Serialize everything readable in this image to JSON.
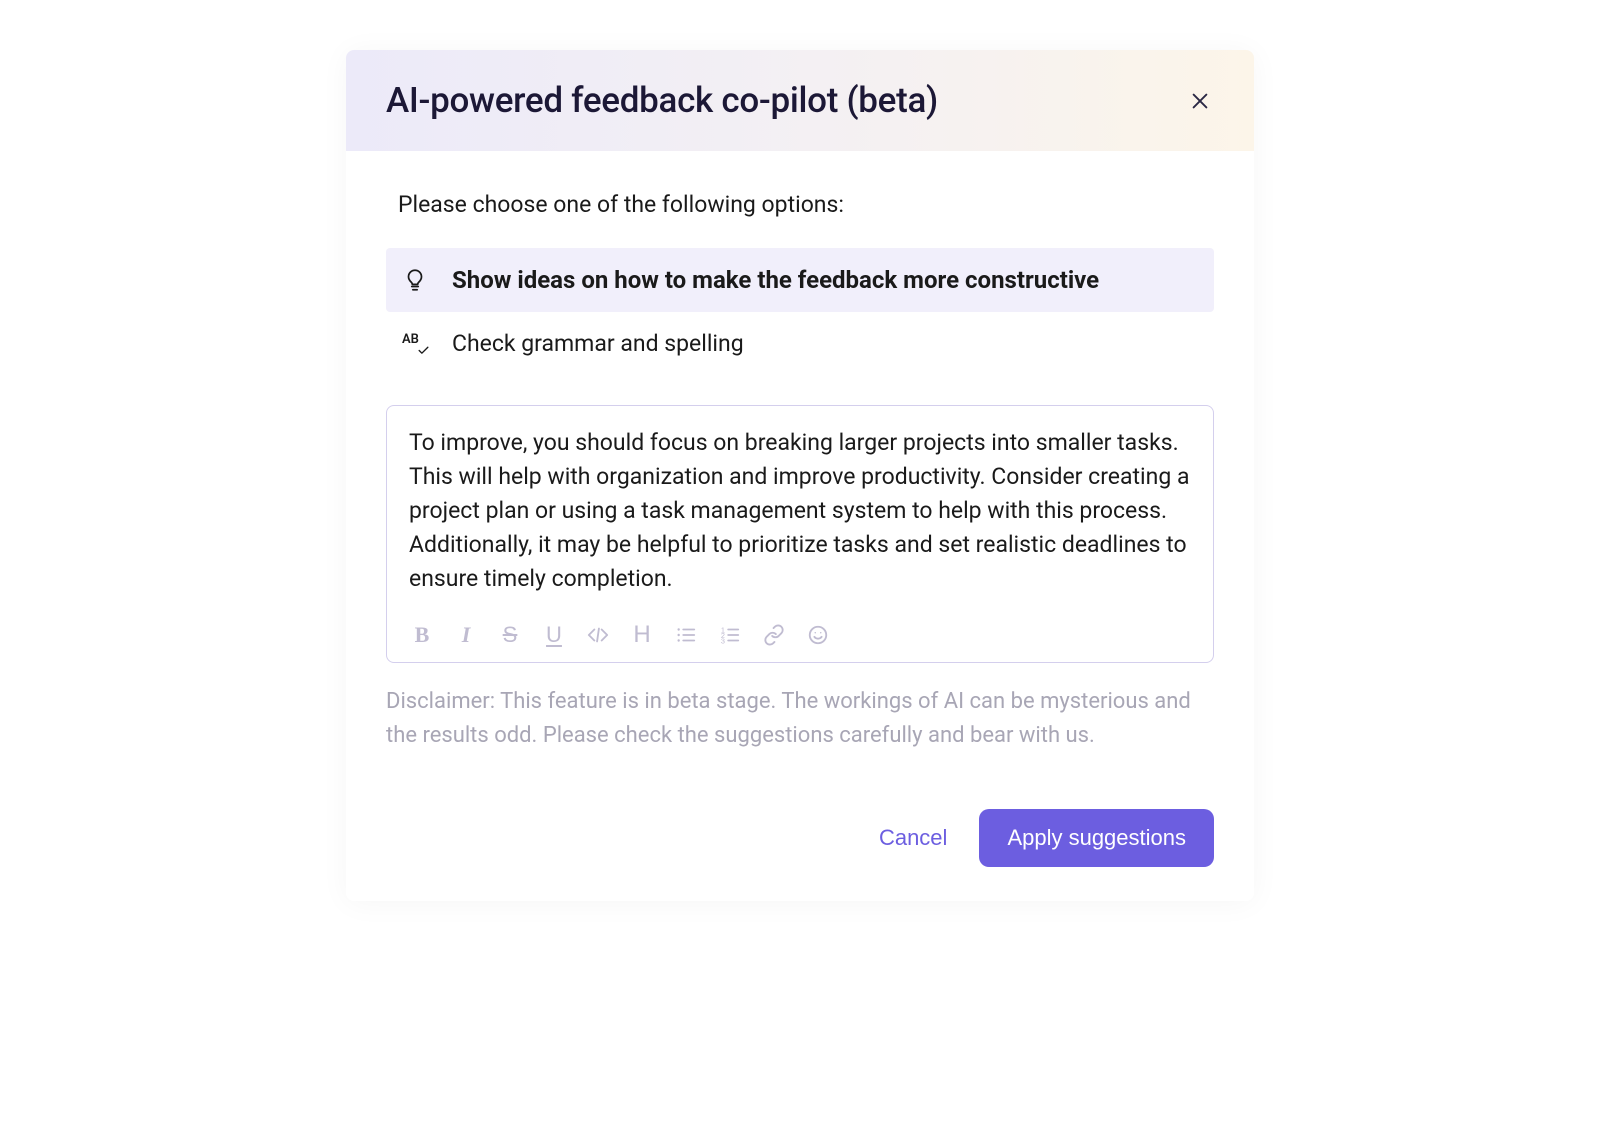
{
  "header": {
    "title": "AI-powered feedback co-pilot (beta)"
  },
  "body": {
    "prompt": "Please choose one of the following options:",
    "options": [
      {
        "label": "Show ideas on how to make the feedback more constructive",
        "selected": true,
        "icon": "lightbulb"
      },
      {
        "label": "Check grammar and spelling",
        "selected": false,
        "icon": "spellcheck"
      }
    ],
    "editor_content": "To improve, you should focus on breaking larger projects into smaller tasks. This will help with organization and improve productivity. Consider creating a project plan or using a task management system to help with this process. Additionally, it may be helpful to prioritize tasks and set realistic deadlines to ensure timely completion.",
    "toolbar": {
      "bold": "B",
      "italic": "I",
      "strike": "S",
      "underline": "U",
      "heading": "H"
    },
    "disclaimer": "Disclaimer: This feature is in beta stage. The workings of AI can be mysterious and the results odd. Please check the suggestions carefully and bear with us."
  },
  "footer": {
    "cancel_label": "Cancel",
    "apply_label": "Apply suggestions"
  }
}
